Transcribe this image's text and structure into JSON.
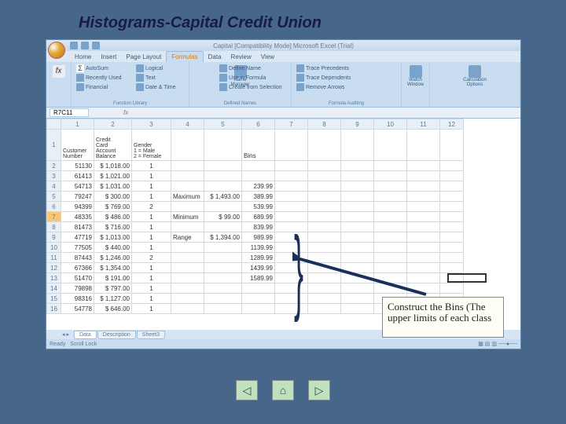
{
  "slide": {
    "title": "Histograms-Capital Credit Union"
  },
  "window": {
    "title": "Capital   [Compatibility Mode]   Microsoft Excel (Trial)"
  },
  "tabs": {
    "home": "Home",
    "insert": "Insert",
    "page_layout": "Page Layout",
    "formulas": "Formulas",
    "data": "Data",
    "review": "Review",
    "view": "View"
  },
  "ribbon": {
    "insert_function": "Insert\nFunction",
    "autosum": "AutoSum",
    "recent": "Recently Used",
    "financial": "Financial",
    "logical": "Logical",
    "text": "Text",
    "date_time": "Date & Time",
    "name_manager": "Name\nManager",
    "define_name": "Define Name",
    "use_in_formula": "Use in Formula",
    "create_from_sel": "Create from Selection",
    "trace_prec": "Trace Precedents",
    "trace_dep": "Trace Dependents",
    "remove_arrows": "Remove Arrows",
    "watch_window": "Watch\nWindow",
    "calc_options": "Calculation\nOptions",
    "group_library": "Function Library",
    "group_defined": "Defined Names",
    "group_auditing": "Formula Auditing"
  },
  "namebox": "R7C11",
  "columns": [
    "",
    "1",
    "2",
    "3",
    "4",
    "5",
    "6",
    "7",
    "8",
    "9",
    "10",
    "11",
    "12"
  ],
  "headers": {
    "customer": "Customer\nNumber",
    "balance": "Credit\nCard\nAccount\nBalance",
    "gender": "Gender\n1 = Male\n2 = Female",
    "bins": "Bins",
    "max": "Maximum",
    "min": "Minimum",
    "range": "Range"
  },
  "stats": {
    "max_val": "$ 1,493.00",
    "min_val": "$    99.00",
    "range_val": "$ 1,394.00"
  },
  "bins": [
    "239.99",
    "389.99",
    "539.99",
    "689.99",
    "839.99",
    "989.99",
    "1139.99",
    "1289.99",
    "1439.99",
    "1589.99"
  ],
  "rows": [
    {
      "r": "2",
      "n": "51130",
      "b": "$ 1,018.00",
      "g": "1"
    },
    {
      "r": "3",
      "n": "61413",
      "b": "$ 1,021.00",
      "g": "1"
    },
    {
      "r": "4",
      "n": "54713",
      "b": "$ 1,031.00",
      "g": "1"
    },
    {
      "r": "5",
      "n": "79247",
      "b": "$   300.00",
      "g": "1"
    },
    {
      "r": "6",
      "n": "94399",
      "b": "$   769.00",
      "g": "2"
    },
    {
      "r": "7",
      "n": "48335",
      "b": "$   486.00",
      "g": "1"
    },
    {
      "r": "8",
      "n": "81473",
      "b": "$   716.00",
      "g": "1"
    },
    {
      "r": "9",
      "n": "47719",
      "b": "$ 1,013.00",
      "g": "1"
    },
    {
      "r": "10",
      "n": "77505",
      "b": "$   440.00",
      "g": "1"
    },
    {
      "r": "11",
      "n": "87443",
      "b": "$ 1,246.00",
      "g": "2"
    },
    {
      "r": "12",
      "n": "67366",
      "b": "$ 1,354.00",
      "g": "1"
    },
    {
      "r": "13",
      "n": "51470",
      "b": "$   191.00",
      "g": "1"
    },
    {
      "r": "14",
      "n": "79898",
      "b": "$   797.00",
      "g": "1"
    },
    {
      "r": "15",
      "n": "98316",
      "b": "$ 1,127.00",
      "g": "1"
    },
    {
      "r": "16",
      "n": "54778",
      "b": "$   646.00",
      "g": "1"
    }
  ],
  "ws_tabs": {
    "data": "Data",
    "desc": "Description",
    "sheet3": "Sheet3"
  },
  "status": {
    "ready": "Ready",
    "scroll": "Scroll Lock"
  },
  "callout": "Construct the Bins (The upper limits of each class",
  "nav": {
    "prev": "◁",
    "home": "⌂",
    "next": "▷"
  }
}
